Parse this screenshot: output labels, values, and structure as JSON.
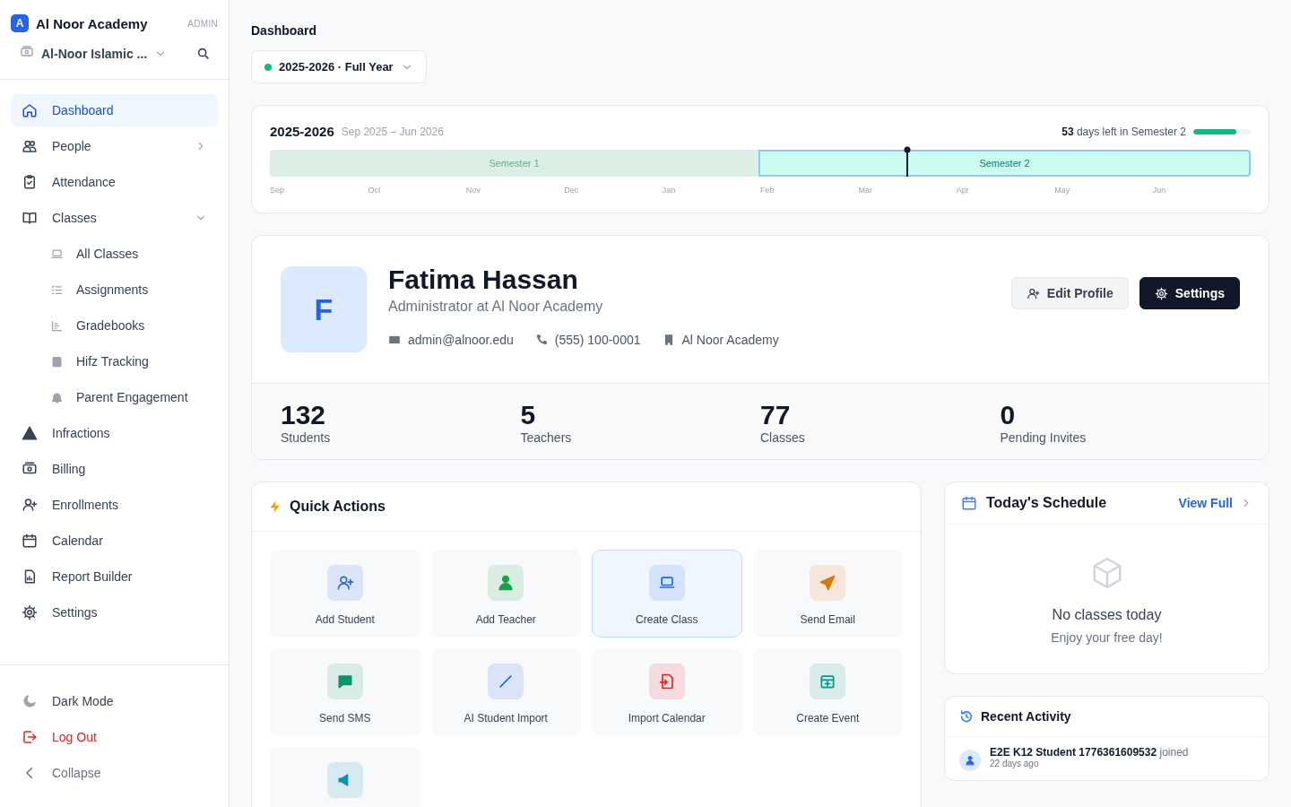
{
  "brand": {
    "logo": "A",
    "name": "Al Noor Academy",
    "role": "ADMIN"
  },
  "school": {
    "name": "Al-Noor Islamic ..."
  },
  "nav": [
    {
      "label": "Dashboard",
      "selected": true
    },
    {
      "label": "People",
      "selected": false,
      "expanded": false
    },
    {
      "label": "Attendance",
      "selected": false
    },
    {
      "label": "Classes",
      "selected": false,
      "expanded": true,
      "children": [
        {
          "label": "All Classes",
          "selected": false
        },
        {
          "label": "Assignments",
          "selected": false
        },
        {
          "label": "Gradebooks",
          "selected": false
        },
        {
          "label": "Hifz Tracking",
          "selected": false
        },
        {
          "label": "Parent Engagement",
          "selected": false
        }
      ]
    },
    {
      "label": "Infractions",
      "selected": false
    },
    {
      "label": "Billing",
      "selected": false
    },
    {
      "label": "Enrollments",
      "selected": false
    },
    {
      "label": "Calendar",
      "selected": false
    },
    {
      "label": "Report Builder",
      "selected": false
    },
    {
      "label": "Settings",
      "selected": false
    }
  ],
  "footer_nav": [
    {
      "label": "Dark Mode",
      "kind": "normal"
    },
    {
      "label": "Log Out",
      "kind": "danger"
    },
    {
      "label": "Collapse",
      "kind": "muted"
    }
  ],
  "breadcrumb": "Dashboard",
  "year_selector": {
    "label": "2025-2026 · Full Year",
    "color": "#10b981"
  },
  "timeline": {
    "title": "2025-2026",
    "range": "Sep 2025 – Jun 2026",
    "days_left": "53",
    "days_text": "days left in Semester 2",
    "level": 0.75,
    "semesters": [
      {
        "label": "Semester 1",
        "selected": false
      },
      {
        "label": "Semester 2",
        "selected": true
      }
    ],
    "today": {
      "level": 0.65
    },
    "months": [
      "Sep",
      "Oct",
      "Nov",
      "Dec",
      "Jan",
      "Feb",
      "Mar",
      "Apr",
      "May",
      "Jun"
    ]
  },
  "profile": {
    "initial": "F",
    "name": "Fatima Hassan",
    "role": "Administrator at Al Noor Academy",
    "email": "admin@alnoor.edu",
    "phone": "(555) 100-0001",
    "organization": "Al Noor Academy",
    "buttons": [
      {
        "label": "Edit Profile",
        "kind": "secondary"
      },
      {
        "label": "Settings",
        "kind": "primary"
      }
    ]
  },
  "stats": [
    {
      "value": "132",
      "label": "Students"
    },
    {
      "value": "5",
      "label": "Teachers"
    },
    {
      "value": "77",
      "label": "Classes"
    },
    {
      "value": "0",
      "label": "Pending Invites"
    }
  ],
  "quick_actions": {
    "title": "Quick Actions",
    "items": [
      {
        "label": "Add Student",
        "color": "#2563eb",
        "selected": false
      },
      {
        "label": "Add Teacher",
        "color": "#16a34a",
        "selected": false
      },
      {
        "label": "Create Class",
        "color": "#2563eb",
        "selected": true
      },
      {
        "label": "Send Email",
        "color": "#d97706",
        "selected": false
      },
      {
        "label": "Send SMS",
        "color": "#059669",
        "selected": false
      },
      {
        "label": "AI Student Import",
        "color": "#2563eb",
        "selected": false
      },
      {
        "label": "Import Calendar",
        "color": "#dc2626",
        "selected": false
      },
      {
        "label": "Create Event",
        "color": "#0d9488",
        "selected": false
      },
      {
        "color": "#0891b2",
        "selected": false
      }
    ]
  },
  "schedule": {
    "title": "Today's Schedule",
    "link": "View Full",
    "empty_title": "No classes today",
    "empty_text": "Enjoy your free day!"
  },
  "activity": {
    "title": "Recent Activity",
    "items": [
      {
        "name": "E2E K12 Student 1776361609532",
        "action": "joined",
        "time": "22 days ago"
      }
    ]
  }
}
